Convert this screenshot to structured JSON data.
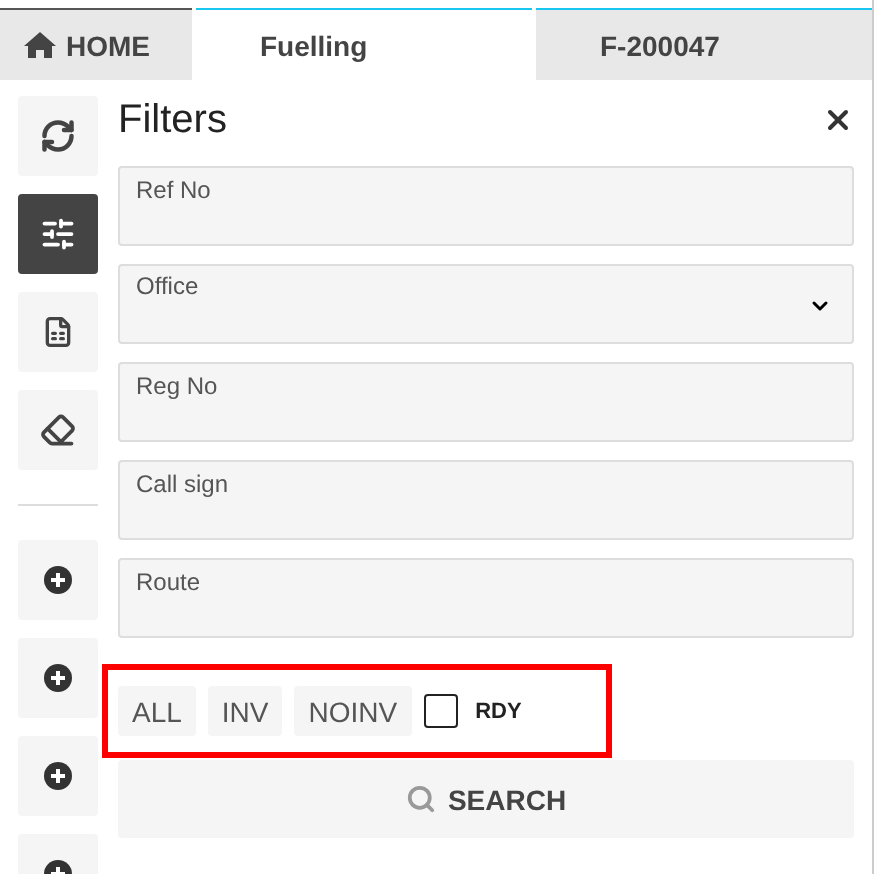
{
  "tabs": [
    {
      "label": "HOME",
      "kind": "home",
      "selected": false
    },
    {
      "label": "Fuelling",
      "kind": "plain",
      "selected": true
    },
    {
      "label": "F-200047",
      "kind": "plain",
      "selected": false
    }
  ],
  "sidebar": {
    "tools": [
      {
        "kind": "refresh",
        "selected": false
      },
      {
        "kind": "filters",
        "selected": true
      },
      {
        "kind": "sheet",
        "selected": false
      },
      {
        "kind": "eraser",
        "selected": false
      }
    ],
    "add_buttons": [
      {
        "kind": "add"
      },
      {
        "kind": "add"
      },
      {
        "kind": "add"
      },
      {
        "kind": "add"
      }
    ]
  },
  "panel": {
    "title": "Filters",
    "fields": [
      {
        "kind": "text",
        "placeholder": "Ref No"
      },
      {
        "kind": "select",
        "placeholder": "Office"
      },
      {
        "kind": "text",
        "placeholder": "Reg No"
      },
      {
        "kind": "text",
        "placeholder": "Call sign"
      },
      {
        "kind": "text",
        "placeholder": "Route"
      }
    ],
    "quick_filters": [
      {
        "label": "ALL",
        "selected": false
      },
      {
        "label": "INV",
        "selected": false
      },
      {
        "label": "NOINV",
        "selected": false
      }
    ],
    "ready_checkbox": {
      "label": "RDY",
      "checked": false
    },
    "search_button": "SEARCH"
  }
}
